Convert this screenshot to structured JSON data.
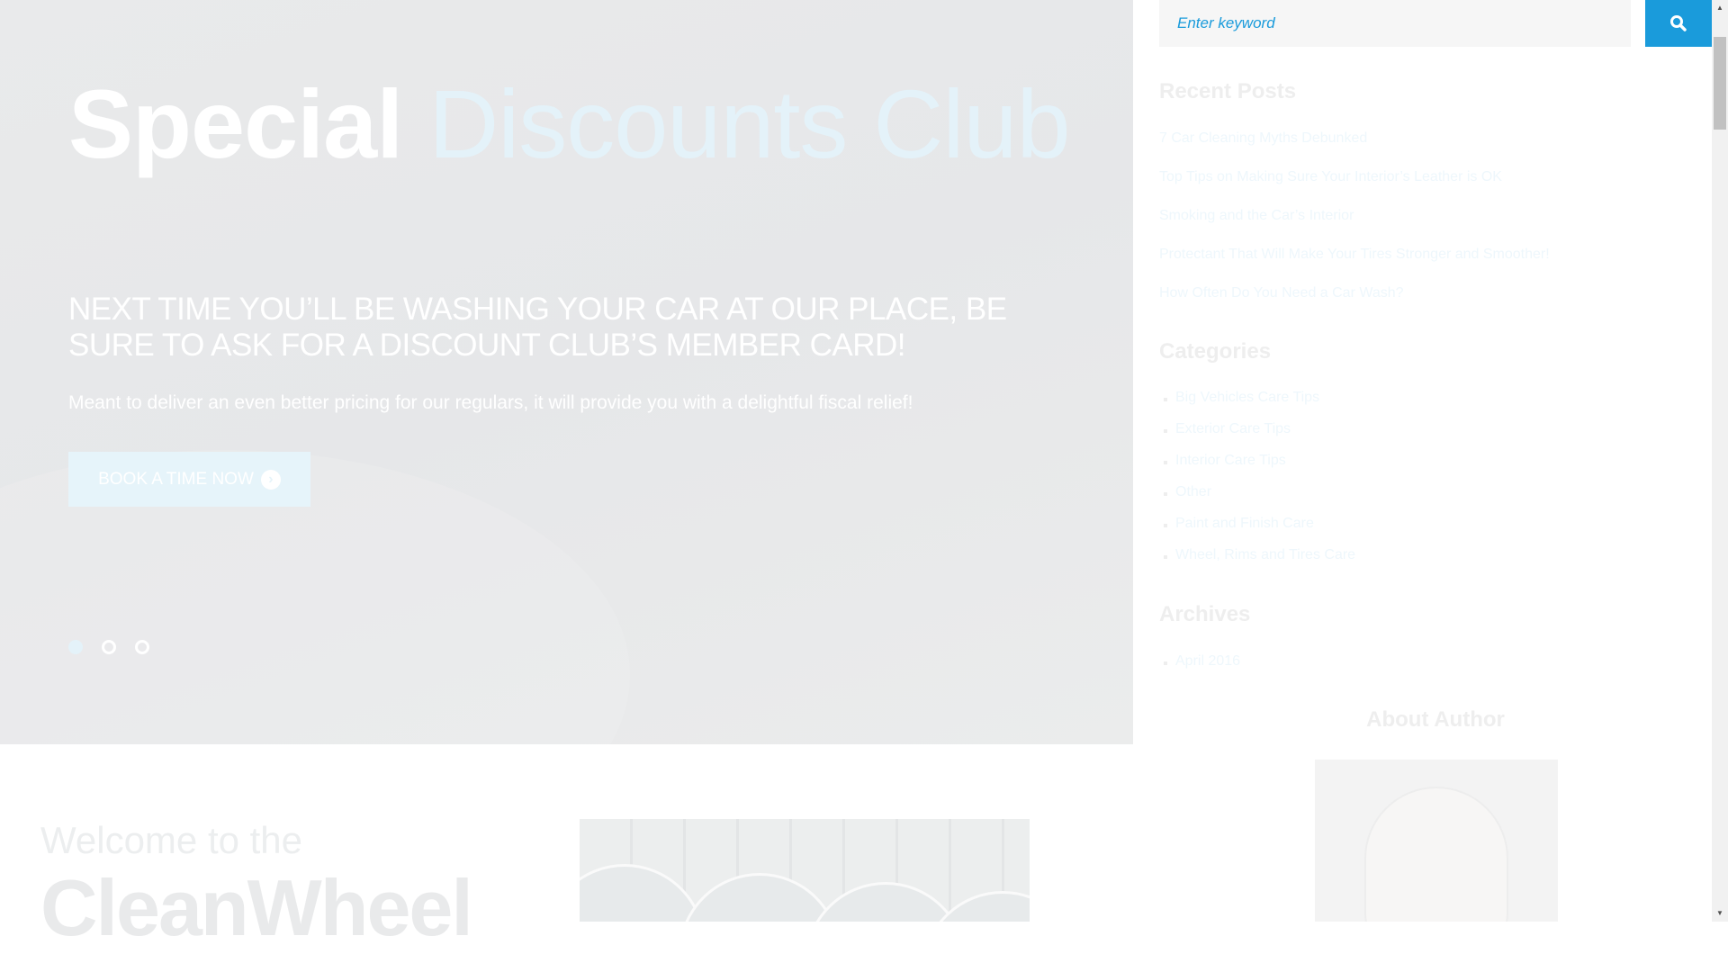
{
  "hero": {
    "title_bold": "Special",
    "title_light": "Discounts Club",
    "subtitle": "Next time you’ll be washing your car at our place, be sure to ask for a discount club’s member card!",
    "paragraph": "Meant to deliver an even better pricing for our regulars, it will provide you with a delightful fiscal relief!",
    "button_label": "BOOK A TIME NOW",
    "button_icon": "chevron-circle-right-icon",
    "slides": 3,
    "active_slide": 1
  },
  "welcome": {
    "line1": "Welcome to the",
    "brand": "CleanWheel"
  },
  "sidebar": {
    "search": {
      "placeholder": "Enter keyword",
      "button_icon": "search-icon"
    },
    "recent_posts": {
      "title": "Recent Posts",
      "items": [
        "7 Car Cleaning Myths Debunked",
        "Top Tips on Making Sure Your Interior’s Leather is OK",
        "Smoking and the Car’s Interior",
        "Protectant That Will Make Your Tires Stronger and Smoother!",
        "How Often Do You Need a Car Wash?"
      ]
    },
    "categories": {
      "title": "Categories",
      "items": [
        "Big Vehicles Care Tips",
        "Exterior Care Tips",
        "Interior Care Tips",
        "Other",
        "Paint and Finish Care",
        "Wheel, Rims and Tires Care"
      ]
    },
    "archives": {
      "title": "Archives",
      "items": [
        "April 2016"
      ]
    },
    "about": {
      "title": "About Author"
    }
  },
  "colors": {
    "accent": "#1a9bdb",
    "hero_light": "#e4f2f9"
  }
}
